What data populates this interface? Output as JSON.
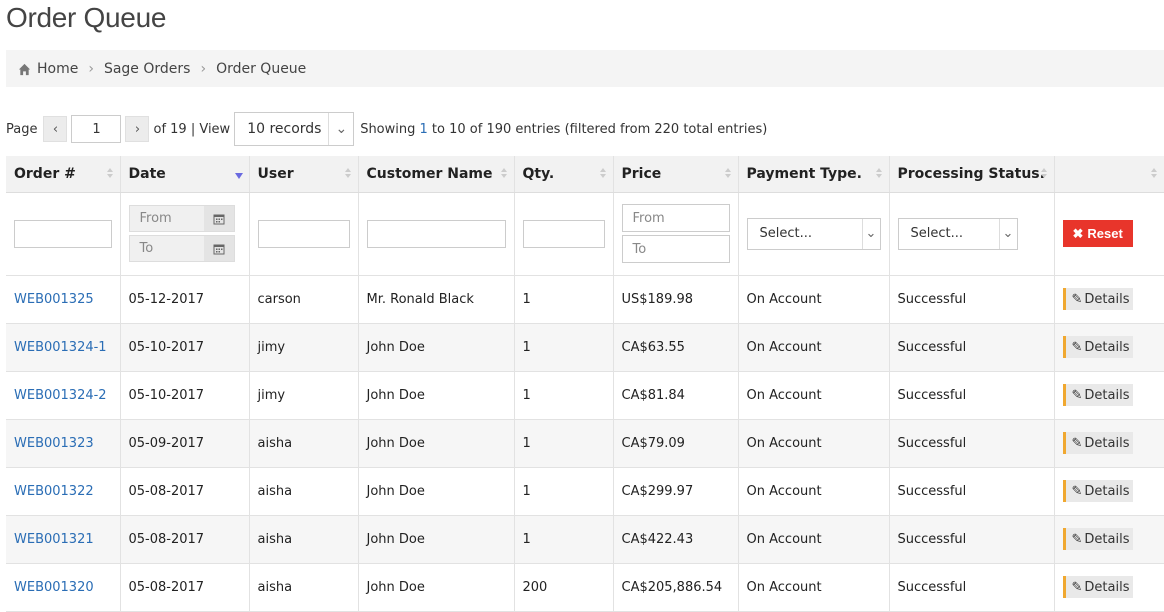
{
  "page": {
    "title": "Order Queue"
  },
  "breadcrumb": {
    "items": [
      "Home",
      "Sage Orders",
      "Order Queue"
    ]
  },
  "pager": {
    "page_label": "Page",
    "prev_icon": "chevron-left",
    "next_icon": "chevron-right",
    "current_page": "1",
    "of_text": "of 19 | View",
    "records_selected": "10 records",
    "showing_prefix": "Showing ",
    "showing_from": "1",
    "showing_mid": " to ",
    "showing_to": "10",
    "showing_suffix": " of 190 entries (filtered from 220 total entries)"
  },
  "table": {
    "columns": [
      "Order #",
      "Date",
      "User",
      "Customer Name",
      "Qty.",
      "Price",
      "Payment Type.",
      "Processing Status.",
      ""
    ],
    "filters": {
      "date_from_placeholder": "From",
      "date_to_placeholder": "To",
      "price_from_placeholder": "From",
      "price_to_placeholder": "To",
      "payment_select": "Select...",
      "status_select": "Select...",
      "reset_label": "Reset"
    },
    "details_label": "Details",
    "rows": [
      {
        "order": "WEB001325",
        "date": "05-12-2017",
        "user": "carson",
        "customer": "Mr. Ronald Black",
        "qty": "1",
        "price": "US$189.98",
        "payment": "On Account",
        "status": "Successful"
      },
      {
        "order": "WEB001324-1",
        "date": "05-10-2017",
        "user": "jimy",
        "customer": "John Doe",
        "qty": "1",
        "price": "CA$63.55",
        "payment": "On Account",
        "status": "Successful"
      },
      {
        "order": "WEB001324-2",
        "date": "05-10-2017",
        "user": "jimy",
        "customer": "John Doe",
        "qty": "1",
        "price": "CA$81.84",
        "payment": "On Account",
        "status": "Successful"
      },
      {
        "order": "WEB001323",
        "date": "05-09-2017",
        "user": "aisha",
        "customer": "John Doe",
        "qty": "1",
        "price": "CA$79.09",
        "payment": "On Account",
        "status": "Successful"
      },
      {
        "order": "WEB001322",
        "date": "05-08-2017",
        "user": "aisha",
        "customer": "John Doe",
        "qty": "1",
        "price": "CA$299.97",
        "payment": "On Account",
        "status": "Successful"
      },
      {
        "order": "WEB001321",
        "date": "05-08-2017",
        "user": "aisha",
        "customer": "John Doe",
        "qty": "1",
        "price": "CA$422.43",
        "payment": "On Account",
        "status": "Successful"
      },
      {
        "order": "WEB001320",
        "date": "05-08-2017",
        "user": "aisha",
        "customer": "John Doe",
        "qty": "200",
        "price": "CA$205,886.54",
        "payment": "On Account",
        "status": "Successful"
      }
    ]
  },
  "colors": {
    "link": "#2a6db5",
    "reset": "#e8352b",
    "details_accent": "#f0a830",
    "sort_active": "#6a6ae0"
  }
}
